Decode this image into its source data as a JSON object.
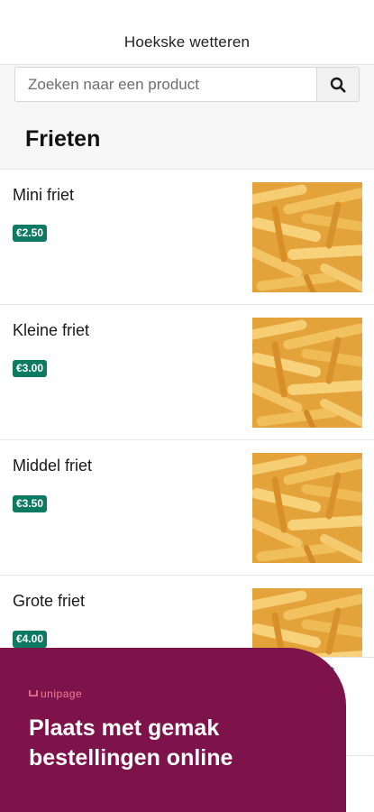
{
  "header": {
    "title": "Hoekske wetteren"
  },
  "search": {
    "placeholder": "Zoeken naar een product",
    "icon": "search-icon"
  },
  "category": {
    "title": "Frieten"
  },
  "products": [
    {
      "name": "Mini friet",
      "price": "€2.50"
    },
    {
      "name": "Kleine friet",
      "price": "€3.00"
    },
    {
      "name": "Middel friet",
      "price": "€3.50"
    },
    {
      "name": "Grote friet",
      "price": "€4.00"
    }
  ],
  "promo": {
    "brand": "unipage",
    "headline_line1": "Plaats met gemak",
    "headline_line2": "bestellingen online"
  },
  "colors": {
    "price_badge": "#0e7a63",
    "promo_bg": "#7d134a",
    "brand_accent": "#f07f92"
  }
}
